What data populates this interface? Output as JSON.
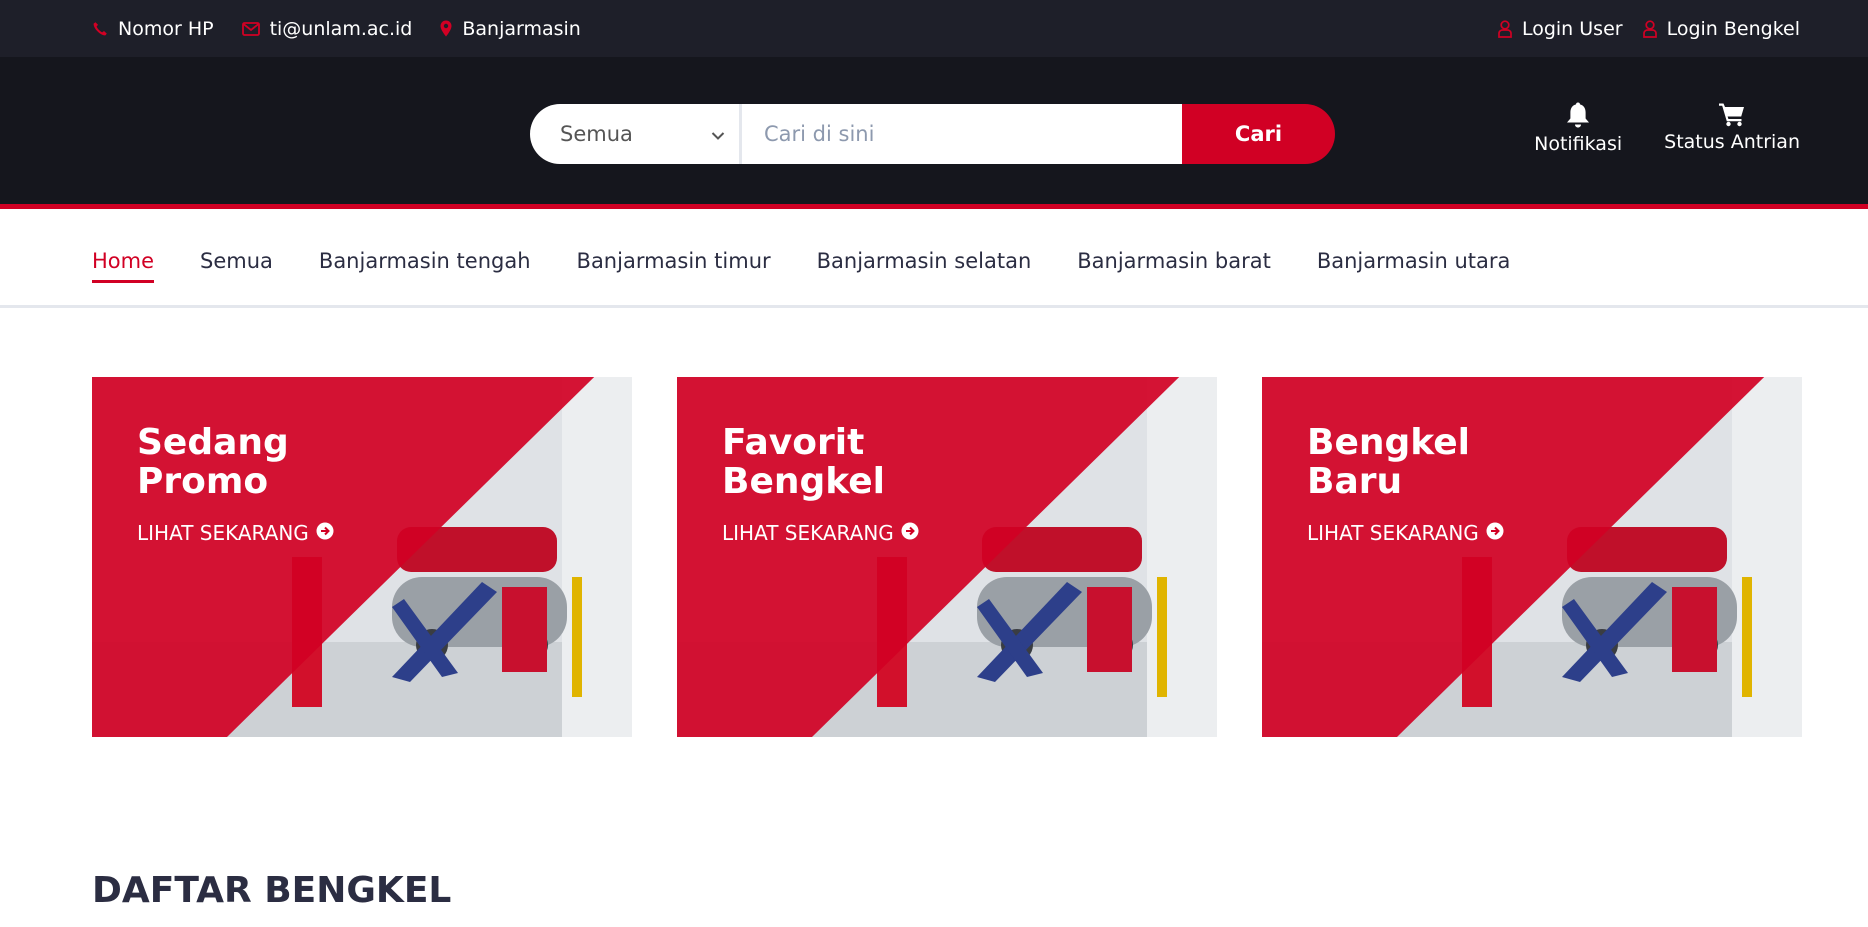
{
  "top_header": {
    "phone": "Nomor HP",
    "email": "ti@unlam.ac.id",
    "location": "Banjarmasin",
    "login_user": "Login User",
    "login_bengkel": "Login Bengkel"
  },
  "search": {
    "category_selected": "Semua",
    "placeholder": "Cari di sini",
    "button_label": "Cari"
  },
  "header_ctas": {
    "notifications_label": "Notifikasi",
    "queue_status_label": "Status Antrian"
  },
  "nav": {
    "items": [
      {
        "label": "Home",
        "active": true
      },
      {
        "label": "Semua"
      },
      {
        "label": "Banjarmasin tengah"
      },
      {
        "label": "Banjarmasin timur"
      },
      {
        "label": "Banjarmasin selatan"
      },
      {
        "label": "Banjarmasin barat"
      },
      {
        "label": "Banjarmasin utara"
      }
    ]
  },
  "shops": [
    {
      "title": "Sedang Promo",
      "cta": "LIHAT SEKARANG"
    },
    {
      "title": "Favorit Bengkel",
      "cta": "LIHAT SEKARANG"
    },
    {
      "title": "Bengkel Baru",
      "cta": "LIHAT SEKARANG"
    }
  ],
  "section": {
    "title": "DAFTAR BENGKEL"
  },
  "colors": {
    "accent": "#D10024",
    "header_dark": "#15161d",
    "top_header_dark": "#1e1f29",
    "text_dark": "#2b2d42"
  },
  "icons": {
    "phone": "phone-icon",
    "email": "envelope-icon",
    "location": "map-marker-icon",
    "user": "user-icon",
    "bell": "bell-icon",
    "cart": "cart-icon",
    "chevron": "chevron-down-icon",
    "arrow": "arrow-circle-right-icon"
  }
}
